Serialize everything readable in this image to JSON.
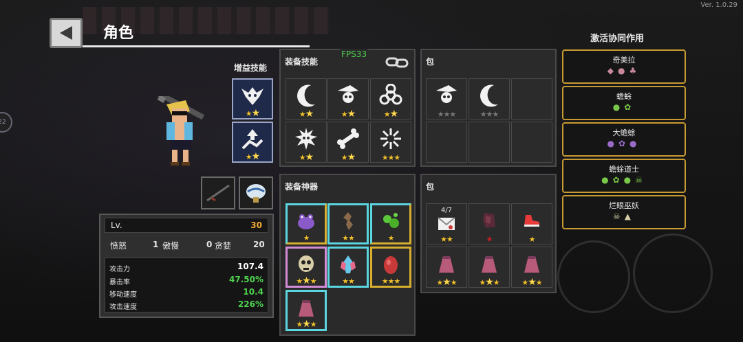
{
  "header": {
    "title": "角色",
    "version": "Ver. 1.0.29"
  },
  "side_button": {
    "label": "22"
  },
  "buff": {
    "label": "增益技能",
    "slots": [
      {
        "icon": "demon-skull-icon",
        "stars": 2
      },
      {
        "icon": "charge-arrow-icon",
        "stars": 2
      }
    ]
  },
  "weapons": [
    {
      "icon": "rifle-icon"
    },
    {
      "icon": "pet-egg-icon"
    }
  ],
  "stats": {
    "lv_label": "Lv.",
    "lv_value": "30",
    "traits": [
      {
        "name": "愤怒",
        "value": "1"
      },
      {
        "name": "傲慢",
        "value": "0"
      },
      {
        "name": "贪婪",
        "value": "20"
      }
    ],
    "rows": [
      {
        "label": "攻击力",
        "value": "107.4",
        "color": "#ffffff"
      },
      {
        "label": "暴击率",
        "value": "47.50%",
        "color": "#4fd24f"
      },
      {
        "label": "移动速度",
        "value": "10.4",
        "color": "#4fd24f"
      },
      {
        "label": "攻击速度",
        "value": "226%",
        "color": "#4fd24f"
      }
    ]
  },
  "skills_panel": {
    "title": "装备技能",
    "fps": "FPS33",
    "slots": [
      {
        "icon": "crescent-slash-icon",
        "stars": 2
      },
      {
        "icon": "witch-skull-icon",
        "stars": 2
      },
      {
        "icon": "biohazard-icon",
        "stars": 2
      },
      {
        "icon": "skull-burst-icon",
        "stars": 2
      },
      {
        "icon": "bone-icon",
        "stars": 2
      },
      {
        "icon": "spark-burst-icon",
        "stars": 3
      }
    ]
  },
  "bag_skills": {
    "title": "包",
    "slots": [
      {
        "icon": "witch-skull-icon",
        "stars": 3,
        "empty_stars": true
      },
      {
        "icon": "crescent-slash-icon",
        "stars": 3,
        "empty_stars": true
      }
    ]
  },
  "artifacts_panel": {
    "title": "装备神器",
    "slots": [
      {
        "icon": "purple-frog-icon",
        "stars": 1,
        "border": "bi"
      },
      {
        "icon": "bronze-lizard-icon",
        "stars": 2,
        "border": "cyan"
      },
      {
        "icon": "green-slime-icon",
        "stars": 1,
        "border": "bi"
      },
      {
        "icon": "skull-mask-icon",
        "stars": 3,
        "border": "pink"
      },
      {
        "icon": "crystal-shard-icon",
        "stars": 2,
        "border": "cyan"
      },
      {
        "icon": "red-egg-icon",
        "stars": 3,
        "border": "yellow"
      },
      {
        "icon": "pink-cloak-icon",
        "stars": 3,
        "border": "cyan"
      }
    ]
  },
  "bag_items": {
    "title": "包",
    "slots": [
      {
        "icon": "letter-icon",
        "stars": 2,
        "counter": "4/7"
      },
      {
        "icon": "dark-gauntlet-icon",
        "stars": 1,
        "red_star": true
      },
      {
        "icon": "red-sneaker-icon",
        "stars": 1
      },
      {
        "icon": "pink-cloak-icon",
        "stars": 3
      },
      {
        "icon": "pink-cloak-icon",
        "stars": 3
      },
      {
        "icon": "pink-cloak-icon",
        "stars": 3
      }
    ]
  },
  "synergy": {
    "title": "激活协同作用",
    "items": [
      {
        "name": "奇美拉",
        "icons": "◆●♣"
      },
      {
        "name": "蟾蜍",
        "icons": "●✿"
      },
      {
        "name": "大蟾蜍",
        "icons": "●✿●"
      },
      {
        "name": "蟾蜍道士",
        "icons": "●✿●☠"
      },
      {
        "name": "烂眼巫妖",
        "icons": "☠▲"
      }
    ]
  },
  "colors": {
    "accent_gold": "#d8ae2f",
    "green_value": "#4fd24f",
    "orange_lv": "#f2a830",
    "fps_green": "#4fd24f"
  }
}
